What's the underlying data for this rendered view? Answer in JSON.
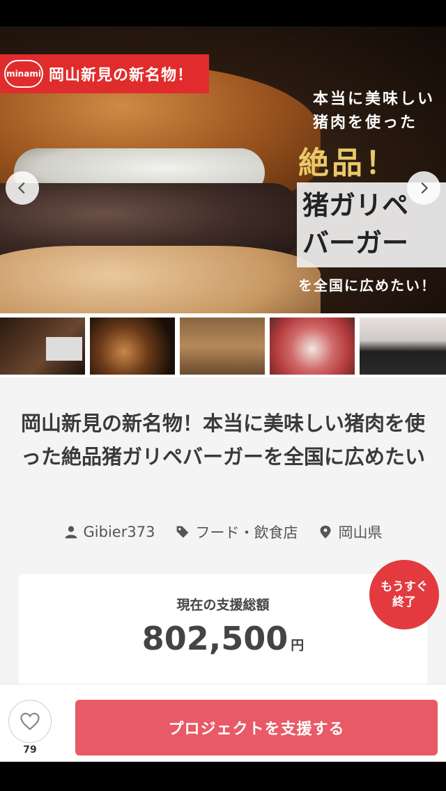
{
  "hero": {
    "badge_logo": "minami",
    "badge_text": "岡山新見の新名物！",
    "copy_line1": "本当に美味しい",
    "copy_line2": "猪肉を使った",
    "copy_emphasis": "絶品！",
    "copy_box_line1": "猪ガリペ",
    "copy_box_line2": "バーガー",
    "copy_bottom": "を全国に広めたい！"
  },
  "project": {
    "title": "岡山新見の新名物！本当に美味しい猪肉を使った絶品猪ガリペバーガーを全国に広めたい",
    "owner": "Gibier373",
    "category": "フード・飲食店",
    "location": "岡山県"
  },
  "funding": {
    "label": "現在の支援総額",
    "amount": "802,500",
    "unit": "円",
    "ending_line1": "もうすぐ",
    "ending_line2": "終了"
  },
  "actions": {
    "favorite_count": "79",
    "support_label": "プロジェクトを支援する"
  },
  "colors": {
    "accent": "#e85a66",
    "badge_red": "#e02c2c",
    "ending_red": "#e23a3e",
    "gold": "#e8c96a"
  },
  "icons": [
    "chevron-left-icon",
    "chevron-right-icon",
    "user-icon",
    "tag-icon",
    "location-pin-icon",
    "heart-icon"
  ]
}
